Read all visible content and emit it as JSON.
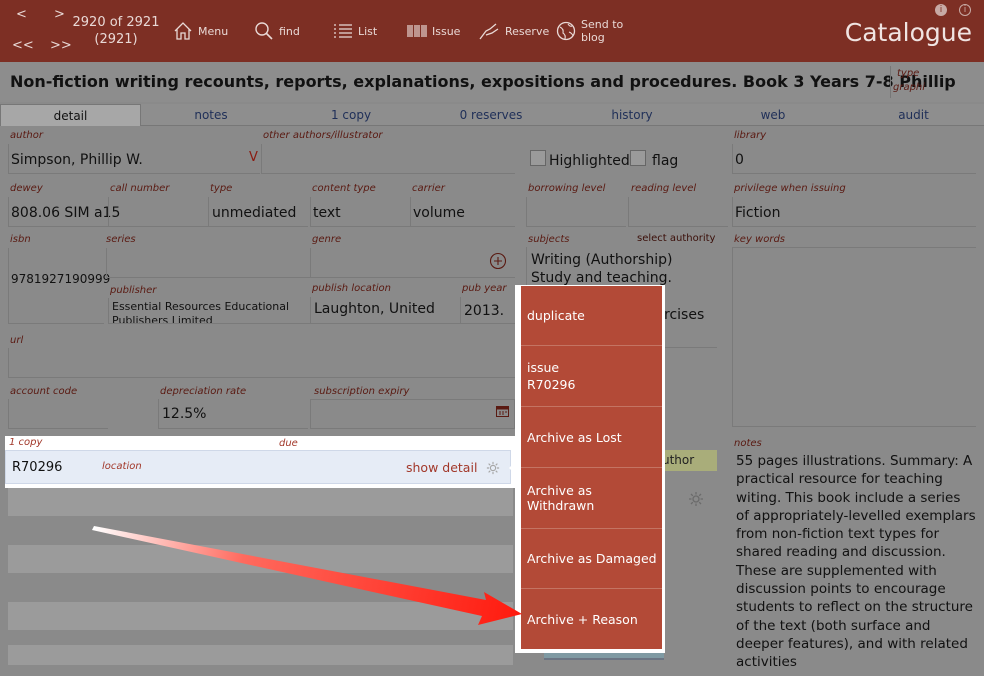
{
  "toolbar": {
    "prev": "<",
    "next": ">",
    "first": "<<",
    "last": ">>",
    "record_position": "2920 of 2921",
    "record_total": "(2921)",
    "menu_label": "Menu",
    "find_label": "find",
    "list_label": "List",
    "issue_label": "Issue",
    "reserve_label": "Reserve",
    "send_line1": "Send to",
    "send_line2": "blog",
    "app_title": "Catalogue",
    "info1": "i",
    "info2": "i"
  },
  "record": {
    "title": "Non-fiction writing recounts, reports, explanations, expositions and procedures. Book 3 Years 7-8 Phillip",
    "type_label": "type",
    "type_value": "graphi"
  },
  "tabs": [
    "detail",
    "notes",
    "1 copy",
    "0 reserves",
    "history",
    "web",
    "audit"
  ],
  "fields": {
    "author_label": "author",
    "author_value": "Simpson, Phillip W.",
    "author_marker": "V",
    "other_authors_label": "other authors/illustrator",
    "highlighted_label": "Highlighted",
    "flag_label": "flag",
    "library_label": "library",
    "library_value": "0",
    "dewey_label": "dewey",
    "dewey_value": "808.06 SIM a15",
    "call_number_label": "call number",
    "type_label": "type",
    "type_value": "unmediated",
    "content_type_label": "content type",
    "content_type_value": "text",
    "carrier_label": "carrier",
    "carrier_value": "volume",
    "borrowing_level_label": "borrowing level",
    "reading_level_label": "reading level",
    "privilege_label": "privilege when issuing",
    "privilege_value": "Fiction",
    "isbn_label": "isbn",
    "isbn_value": "9781927190999",
    "series_label": "series",
    "genre_label": "genre",
    "subjects_label": "subjects",
    "select_authority": "select authority",
    "subject_1": "Writing (Authorship)",
    "subject_2": "Study and teaching.",
    "subject_3_tail": "rcises",
    "keywords_label": "key words",
    "publisher_label": "publisher",
    "publisher_value": "Essential Resources Educational Publishers Limited",
    "publish_location_label": "publish location",
    "publish_location_value": "Laughton, United",
    "pub_year_label": "pub year",
    "pub_year_value": "2013.",
    "url_label": "url",
    "account_code_label": "account code",
    "depreciation_label": "depreciation rate",
    "depreciation_value": "12.5%",
    "subscription_label": "subscription expiry",
    "author_button_tail": "uthor",
    "notes_label": "notes"
  },
  "copies": {
    "header": "1 copy",
    "due_label": "due",
    "barcode": "R70296",
    "location_label": "location",
    "show_detail": "show detail"
  },
  "context_menu": {
    "items": [
      {
        "line1": "duplicate",
        "line2": ""
      },
      {
        "line1": "issue",
        "line2": "R70296"
      },
      {
        "line1": "Archive as Lost",
        "line2": ""
      },
      {
        "line1": "Archive as Withdrawn",
        "line2": ""
      },
      {
        "line1": "Archive as Damaged",
        "line2": ""
      },
      {
        "line1": "Archive + Reason",
        "line2": ""
      }
    ]
  },
  "notes_text": "55 pages illustrations. Summary: A practical resource for teaching witing. This book include a series of appropriately-levelled exemplars from non-fiction text types for shared reading and discussion. These are supplemented with discussion points to encourage students to reflect on the structure of the text (both surface and deeper features), and with related activities",
  "colors": {
    "toolbar": "#7d2f24",
    "menu": "#b34a37",
    "label": "#5a1a12",
    "arrow": "#ff2a1a"
  }
}
